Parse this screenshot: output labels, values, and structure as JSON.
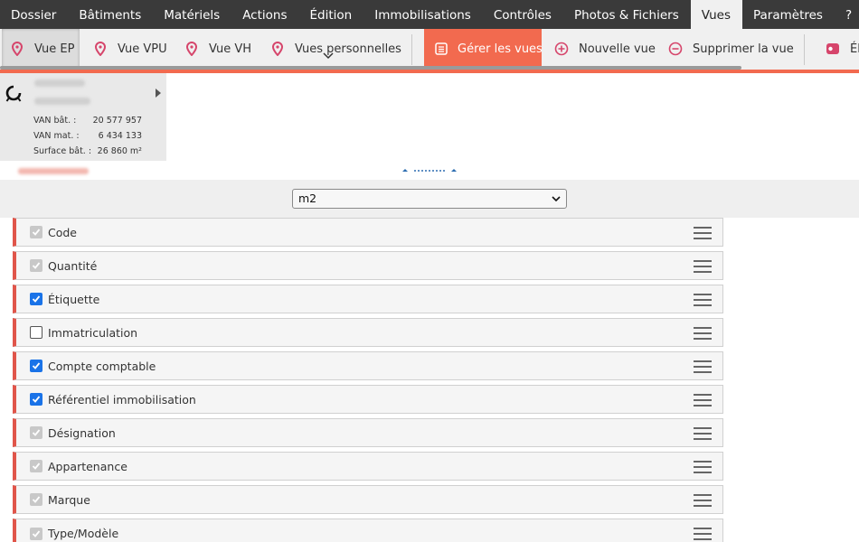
{
  "menu": [
    "Dossier",
    "Bâtiments",
    "Matériels",
    "Actions",
    "Édition",
    "Immobilisations",
    "Contrôles",
    "Photos & Fichiers",
    "Vues",
    "Paramètres",
    "?"
  ],
  "ribbon": {
    "vue_ep": "Vue EP",
    "vue_vpu": "Vue VPU",
    "vue_vh": "Vue VH",
    "vues_personnelles": "Vues personnelles",
    "gerer_vues": "Gérer les vues",
    "nouvelle_vue": "Nouvelle vue",
    "supprimer_vue": "Supprimer la vue",
    "cut_label": "Él"
  },
  "summary": {
    "stats": [
      {
        "label": "VAN bât. :",
        "value": "20 577 957"
      },
      {
        "label": "VAN mat. :",
        "value": "6 434 133"
      },
      {
        "label": "Surface bât. :",
        "value": "26 860 m²"
      }
    ]
  },
  "view_select": {
    "value": "m2"
  },
  "fields": [
    {
      "label": "Code",
      "state": "locked"
    },
    {
      "label": "Quantité",
      "state": "locked"
    },
    {
      "label": "Étiquette",
      "state": "checked"
    },
    {
      "label": "Immatriculation",
      "state": "unchecked"
    },
    {
      "label": "Compte comptable",
      "state": "checked"
    },
    {
      "label": "Référentiel immobilisation",
      "state": "checked"
    },
    {
      "label": "Désignation",
      "state": "locked"
    },
    {
      "label": "Appartenance",
      "state": "locked"
    },
    {
      "label": "Marque",
      "state": "locked"
    },
    {
      "label": "Type/Modèle",
      "state": "locked"
    }
  ],
  "colors": {
    "accent": "#f26a4f",
    "menubar": "#3a3a3a",
    "checkbox": "#1a73e8",
    "row_border": "#e0554a"
  }
}
